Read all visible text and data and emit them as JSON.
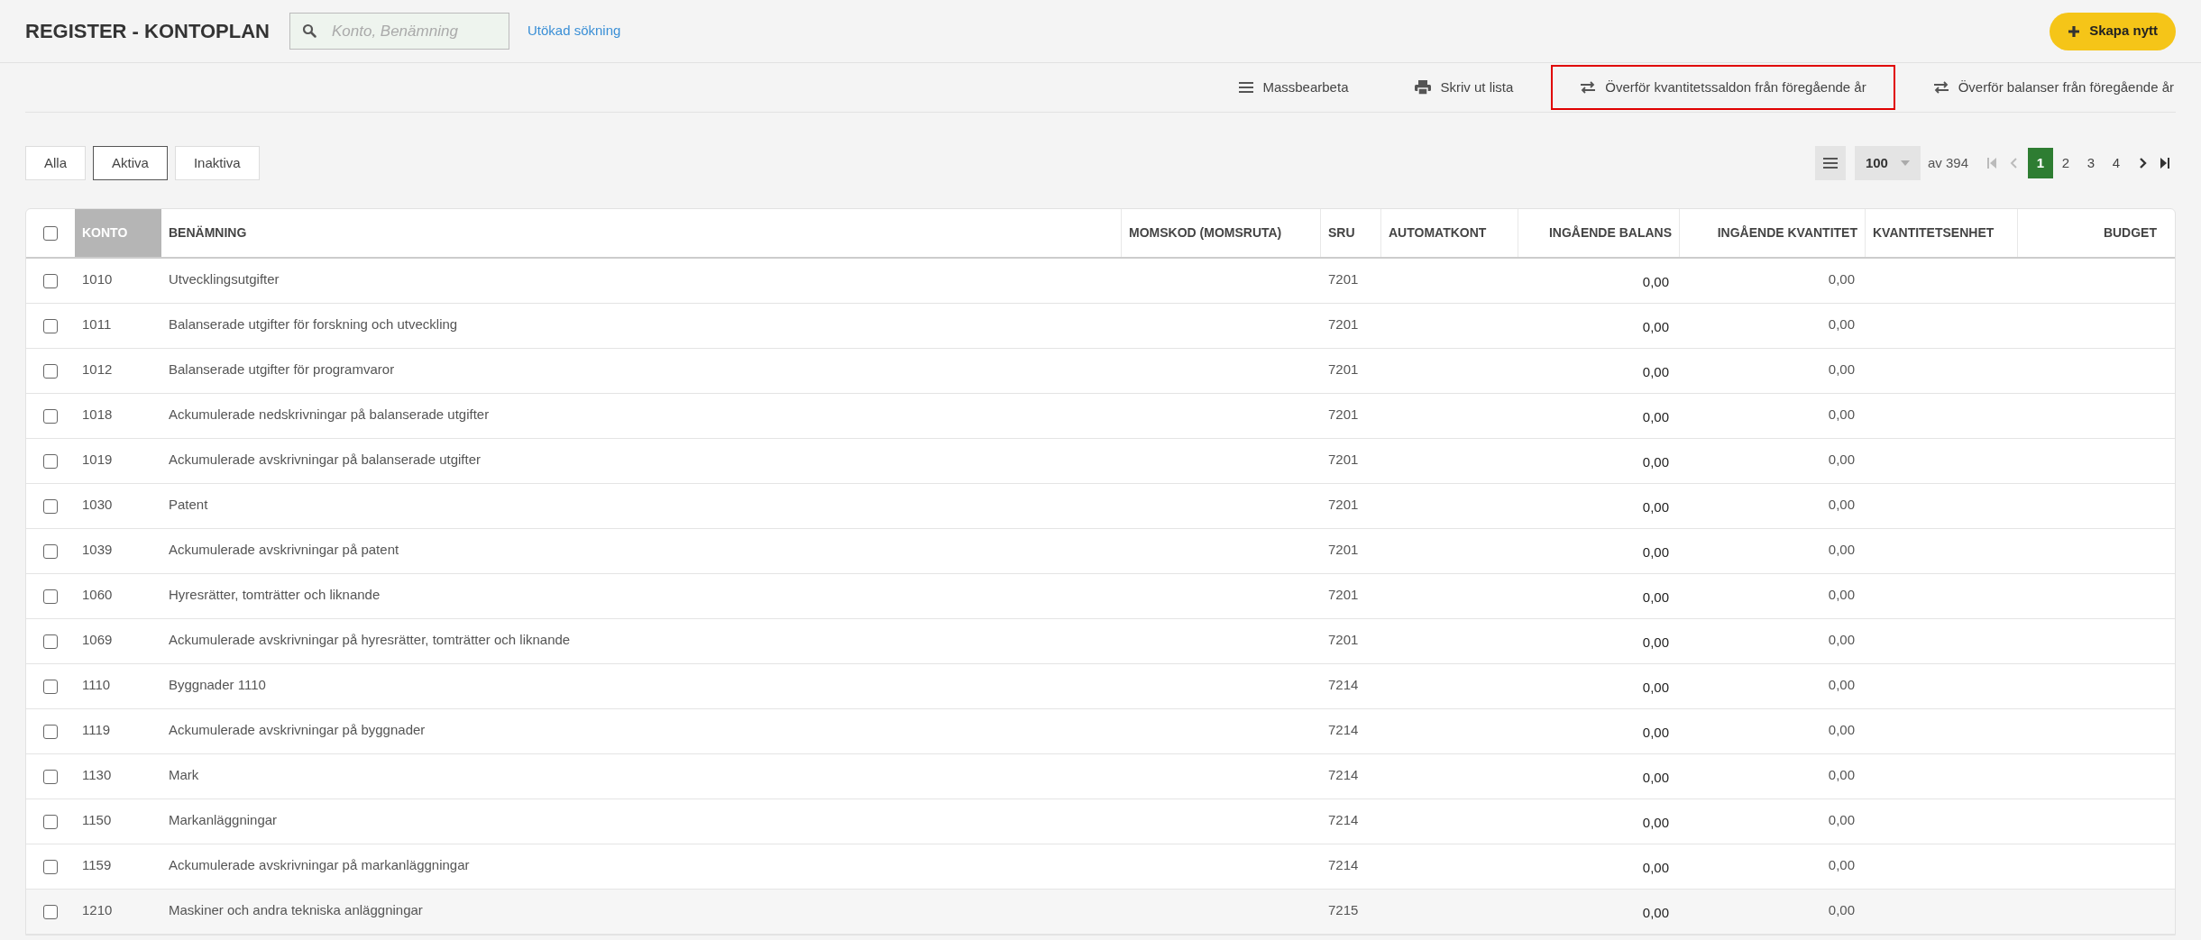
{
  "header": {
    "title": "REGISTER - KONTOPLAN",
    "search": {
      "placeholder": "Konto, Benämning"
    },
    "advanced_search": "Utökad sökning",
    "create_button": "Skapa nytt"
  },
  "toolbar": [
    {
      "kind": "bars",
      "label": "Massbearbeta",
      "highlighted": false
    },
    {
      "kind": "print",
      "label": "Skriv ut lista",
      "highlighted": false
    },
    {
      "kind": "transfer",
      "label": "Överför kvantitetssaldon från föregående år",
      "highlighted": true
    },
    {
      "kind": "transfer",
      "label": "Överför balanser från föregående år",
      "highlighted": false
    }
  ],
  "filters": [
    {
      "label": "Alla",
      "selected": false
    },
    {
      "label": "Aktiva",
      "selected": true
    },
    {
      "label": "Inaktiva",
      "selected": false
    }
  ],
  "pagination": {
    "page_size": "100",
    "total": "av 394",
    "pages": [
      {
        "label": "1",
        "selected": true
      },
      {
        "label": "2",
        "selected": false
      },
      {
        "label": "3",
        "selected": false
      },
      {
        "label": "4",
        "selected": false
      }
    ]
  },
  "table": {
    "select_all": false,
    "columns": [
      "KONTO",
      "BENÄMNING",
      "MOMSKOD (MOMSRUTA)",
      "SRU",
      "AUTOMATKONT",
      "INGÅENDE BALANS",
      "INGÅENDE KVANTITET",
      "KVANTITETSENHET",
      "BUDGET"
    ],
    "rows": [
      {
        "checked": false,
        "konto": "1010",
        "name": "Utvecklingsutgifter",
        "sru": "7201",
        "balance": "0,00",
        "quantity": "0,00"
      },
      {
        "checked": false,
        "konto": "1011",
        "name": "Balanserade utgifter för forskning och utveckling",
        "sru": "7201",
        "balance": "0,00",
        "quantity": "0,00"
      },
      {
        "checked": false,
        "konto": "1012",
        "name": "Balanserade utgifter för programvaror",
        "sru": "7201",
        "balance": "0,00",
        "quantity": "0,00"
      },
      {
        "checked": false,
        "konto": "1018",
        "name": "Ackumulerade nedskrivningar på balanserade utgifter",
        "sru": "7201",
        "balance": "0,00",
        "quantity": "0,00"
      },
      {
        "checked": false,
        "konto": "1019",
        "name": "Ackumulerade avskrivningar på balanserade utgifter",
        "sru": "7201",
        "balance": "0,00",
        "quantity": "0,00"
      },
      {
        "checked": false,
        "konto": "1030",
        "name": "Patent",
        "sru": "7201",
        "balance": "0,00",
        "quantity": "0,00"
      },
      {
        "checked": false,
        "konto": "1039",
        "name": "Ackumulerade avskrivningar på patent",
        "sru": "7201",
        "balance": "0,00",
        "quantity": "0,00"
      },
      {
        "checked": false,
        "konto": "1060",
        "name": "Hyresrätter, tomträtter och liknande",
        "sru": "7201",
        "balance": "0,00",
        "quantity": "0,00"
      },
      {
        "checked": false,
        "konto": "1069",
        "name": "Ackumulerade avskrivningar på hyresrätter, tomträtter och liknande",
        "sru": "7201",
        "balance": "0,00",
        "quantity": "0,00"
      },
      {
        "checked": false,
        "konto": "1110",
        "name": "Byggnader 1110",
        "sru": "7214",
        "balance": "0,00",
        "quantity": "0,00"
      },
      {
        "checked": false,
        "konto": "1119",
        "name": "Ackumulerade avskrivningar på byggnader",
        "sru": "7214",
        "balance": "0,00",
        "quantity": "0,00"
      },
      {
        "checked": false,
        "konto": "1130",
        "name": "Mark",
        "sru": "7214",
        "balance": "0,00",
        "quantity": "0,00"
      },
      {
        "checked": false,
        "konto": "1150",
        "name": "Markanläggningar",
        "sru": "7214",
        "balance": "0,00",
        "quantity": "0,00"
      },
      {
        "checked": false,
        "konto": "1159",
        "name": "Ackumulerade avskrivningar på markanläggningar",
        "sru": "7214",
        "balance": "0,00",
        "quantity": "0,00"
      },
      {
        "checked": false,
        "konto": "1210",
        "name": "Maskiner och andra tekniska anläggningar",
        "sru": "7215",
        "balance": "0,00",
        "quantity": "0,00"
      }
    ]
  }
}
